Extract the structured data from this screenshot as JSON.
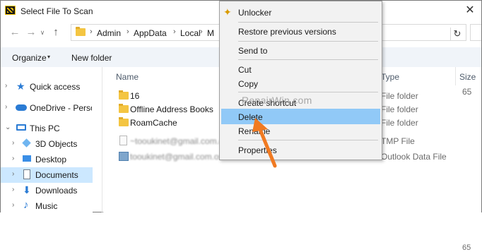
{
  "window": {
    "title": "Select File To Scan",
    "close_glyph": "✕"
  },
  "address": {
    "breadcrumbs": [
      "Admin",
      "AppData",
      "Local",
      "M"
    ],
    "separator": "›",
    "refresh_glyph": "↻"
  },
  "toolbar": {
    "organize_label": "Organize",
    "organize_caret": "▾",
    "new_folder_label": "New folder"
  },
  "navigation": {
    "back_glyph": "←",
    "forward_glyph": "→",
    "recent_glyph": "∨",
    "up_glyph": "↑",
    "items": [
      {
        "label": "Quick access",
        "icon": "star-icon",
        "chevron": "›"
      },
      {
        "label": "OneDrive - Persor",
        "icon": "cloud-icon",
        "chevron": "›"
      },
      {
        "label": "This PC",
        "icon": "computer-icon",
        "chevron": "⌄"
      },
      {
        "label": "3D Objects",
        "icon": "3d-objects-icon",
        "chevron": "›"
      },
      {
        "label": "Desktop",
        "icon": "desktop-icon",
        "chevron": "›"
      },
      {
        "label": "Documents",
        "icon": "documents-icon",
        "chevron": "›",
        "selected": true
      },
      {
        "label": "Downloads",
        "icon": "downloads-icon",
        "chevron": "›"
      },
      {
        "label": "Music",
        "icon": "music-icon",
        "chevron": "›"
      }
    ]
  },
  "file_list": {
    "columns": {
      "name": "Name",
      "type": "Type",
      "size": "Size"
    },
    "rows": [
      {
        "name": "16",
        "type": "File folder",
        "size": "",
        "icon": "folder-icon"
      },
      {
        "name": "Offline Address Books",
        "type": "File folder",
        "size": "",
        "icon": "folder-icon"
      },
      {
        "name": "RoamCache",
        "type": "File folder",
        "size": "",
        "icon": "folder-icon"
      },
      {
        "name": "~tooukinet@gmail.com.o",
        "type": "TMP File",
        "size": "",
        "icon": "tmp-file-icon",
        "blurred": true
      },
      {
        "name": "tooukinet@gmail.com.os",
        "type": "Outlook Data File",
        "size": "",
        "icon": "outlook-data-icon",
        "blurred": true
      }
    ],
    "size_partial_top": "65",
    "size_partial_bottom": "65"
  },
  "context_menu": {
    "items": [
      {
        "label": "Unlocker",
        "icon": "unlocker-wand-icon"
      },
      {
        "label": "Restore previous versions"
      },
      {
        "label": "Send to"
      },
      {
        "label": "Cut"
      },
      {
        "label": "Copy"
      },
      {
        "label": "Create shortcut"
      },
      {
        "label": "Delete",
        "highlighted": true
      },
      {
        "label": "Rename"
      },
      {
        "label": "Properties"
      }
    ]
  },
  "watermark": {
    "text": "RepairWin.com"
  },
  "colors": {
    "selection": "#cce8ff",
    "menu_hover": "#91c9f7",
    "arrow": "#f07a22",
    "folder": "#f4c542"
  }
}
